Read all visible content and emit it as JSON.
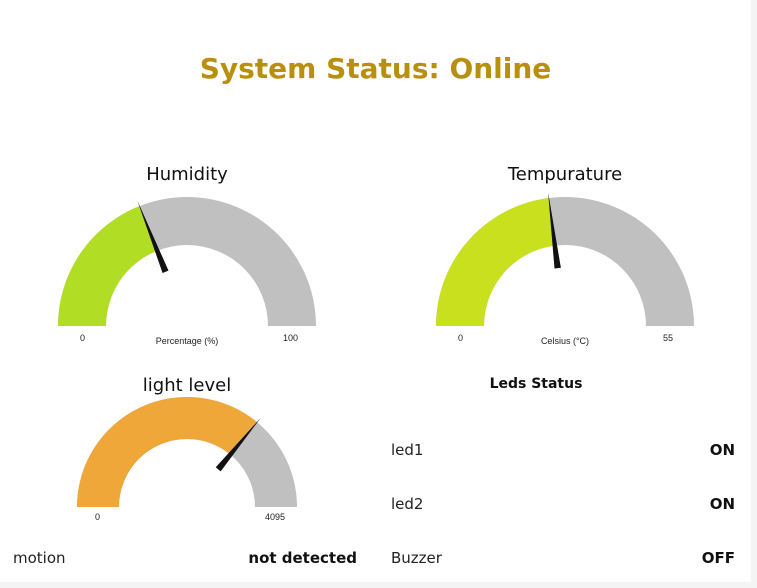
{
  "status_title": "System Status: Online",
  "gauges": {
    "humidity": {
      "title": "Humidity",
      "min": "0",
      "max": "100",
      "unit": "Percentage (%)",
      "value_fraction": 0.38,
      "fill_color": "#b1de24",
      "track_color": "#c0c0c0"
    },
    "temperature": {
      "title": "Tempurature",
      "min": "0",
      "max": "55",
      "unit": "Celsius (°C)",
      "value_fraction": 0.46,
      "fill_color": "#c9e01f",
      "track_color": "#c0c0c0"
    },
    "light": {
      "title": "light level",
      "min": "0",
      "max": "4095",
      "unit": "",
      "value_fraction": 0.72,
      "fill_color": "#efa73a",
      "track_color": "#c0c0c0"
    }
  },
  "leds": {
    "title": "Leds Status",
    "items": [
      {
        "label": "led1",
        "value": "ON"
      },
      {
        "label": "led2",
        "value": "ON"
      },
      {
        "label": "Buzzer",
        "value": "OFF"
      }
    ]
  },
  "motion": {
    "label": "motion",
    "value": "not detected"
  },
  "needle_color": "#111111"
}
